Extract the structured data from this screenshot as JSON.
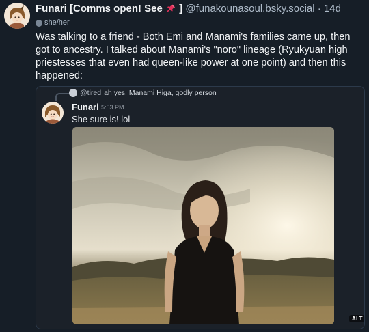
{
  "post": {
    "display_name": "Funari [Comms open! See",
    "display_name_suffix": "]",
    "handle": "@funakounasoul.bsky.social",
    "separator": "·",
    "age": "14d",
    "pronouns": "she/her",
    "body": "Was talking to a friend - Both Emi and Manami's families came up, then got to ancestry. I talked about Manami's \"noro\" lineage (Ryukyuan high priestesses that even had queen-like power at one point) and then this happened:"
  },
  "embed": {
    "reply_to_user": "@tired",
    "reply_to_text": "ah yes, Manami Higa, godly person",
    "message_author": "Funari",
    "message_time": "5:53 PM",
    "message_text": "She sure is!  lol",
    "alt_label": "ALT"
  },
  "colors": {
    "background": "#161e27",
    "text": "#f1f3f5",
    "muted": "#aebbc9",
    "pin": "#e0305a"
  },
  "icons": {
    "pin": "pushpin-icon",
    "pronouns": "pronoun-badge-icon"
  }
}
